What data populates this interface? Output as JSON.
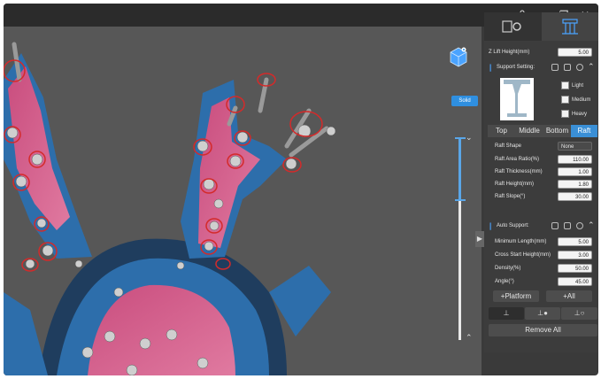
{
  "window": {
    "controls": {
      "user_icon": "user-icon",
      "minimize": "—",
      "restore": "❐",
      "close": "✕"
    }
  },
  "viewport": {
    "view_mode_label": "Solid",
    "view_cube_icon": "view-cube-icon",
    "slider_up_chevron": "⌃",
    "slider_down_chevron": "⌄"
  },
  "panel": {
    "tabs": [
      {
        "icon": "slice-settings-icon",
        "active": false
      },
      {
        "icon": "support-icon",
        "active": true
      }
    ],
    "z_lift": {
      "label": "Z Lift Height(mm)",
      "value": "5.00"
    },
    "support_setting": {
      "label": "Support Setting:",
      "options": [
        {
          "label": "Light",
          "checked": false
        },
        {
          "label": "Medium",
          "checked": false
        },
        {
          "label": "Heavy",
          "checked": false
        }
      ],
      "tabs": [
        "Top",
        "Middle",
        "Bottom",
        "Raft"
      ],
      "active_tab": "Raft"
    },
    "raft": {
      "shape_label": "Raft Shape",
      "shape_value": "None",
      "fields": [
        {
          "label": "Raft Area Ratio(%)",
          "value": "110.00"
        },
        {
          "label": "Raft Thickness(mm)",
          "value": "1.00"
        },
        {
          "label": "Raft Height(mm)",
          "value": "1.80"
        },
        {
          "label": "Raft Slope(°)",
          "value": "30.00"
        }
      ]
    },
    "auto_support": {
      "label": "Auto Support:",
      "fields": [
        {
          "label": "Minimum Length(mm)",
          "value": "5.00"
        },
        {
          "label": "Cross Start Height(mm)",
          "value": "3.00"
        },
        {
          "label": "Density(%)",
          "value": "50.00"
        },
        {
          "label": "Angle(°)",
          "value": "45.00"
        }
      ],
      "platform_button": "+Platform",
      "all_button": "+All",
      "tools": [
        "support-tool-1-icon",
        "support-tool-2-icon",
        "support-tool-3-icon"
      ],
      "remove_all": "Remove All"
    }
  },
  "colors": {
    "accent": "#3a8fd6",
    "model_blue": "#2d6eab",
    "model_pink": "#d05a86",
    "support_ring": "#d42a2a"
  }
}
